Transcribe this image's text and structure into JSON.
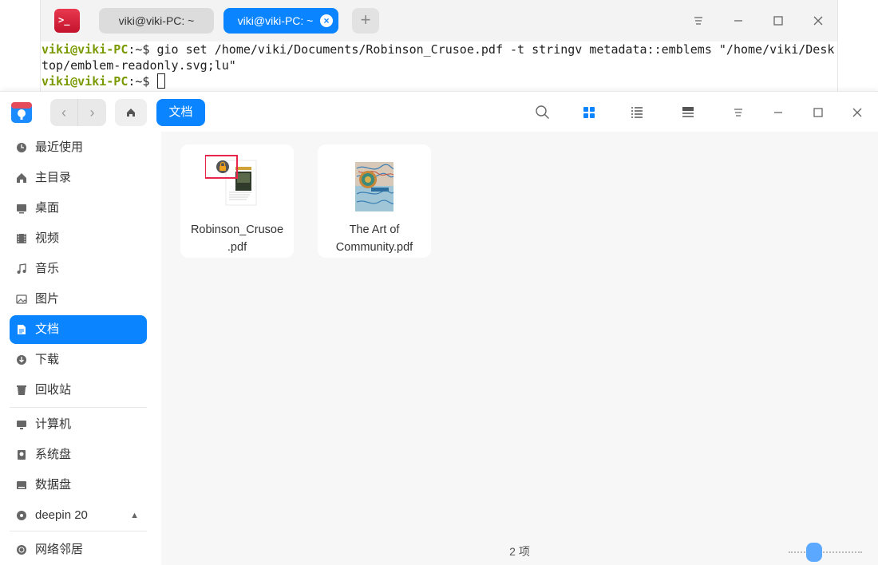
{
  "terminal": {
    "tabs": [
      {
        "label": "viki@viki-PC: ~"
      },
      {
        "label": "viki@viki-PC: ~"
      }
    ],
    "lines": [
      {
        "user": "viki@viki-PC",
        "path": ":~$",
        "command": " gio set /home/viki/Documents/Robinson_Crusoe.pdf -t stringv metadata::emblems \"/home/viki/Desk"
      },
      {
        "continuation": "top/emblem-readonly.svg;lu\""
      },
      {
        "user": "viki@viki-PC",
        "path": ":~$",
        "command": " "
      }
    ]
  },
  "file_manager": {
    "breadcrumb": "文档",
    "sidebar": {
      "items": [
        {
          "label": "最近使用",
          "icon": "clock-icon"
        },
        {
          "label": "主目录",
          "icon": "home-icon"
        },
        {
          "label": "桌面",
          "icon": "desktop-icon"
        },
        {
          "label": "视频",
          "icon": "video-icon"
        },
        {
          "label": "音乐",
          "icon": "music-icon"
        },
        {
          "label": "图片",
          "icon": "picture-icon"
        },
        {
          "label": "文档",
          "icon": "document-icon",
          "active": true
        },
        {
          "label": "下载",
          "icon": "download-icon"
        },
        {
          "label": "回收站",
          "icon": "trash-icon"
        }
      ],
      "devices": [
        {
          "label": "计算机",
          "icon": "computer-icon"
        },
        {
          "label": "系统盘",
          "icon": "disk-icon"
        },
        {
          "label": "数据盘",
          "icon": "disk-icon"
        },
        {
          "label": "deepin 20",
          "icon": "optical-disc-icon",
          "eject": "▲"
        }
      ],
      "network": {
        "label": "网络邻居",
        "icon": "network-icon"
      }
    },
    "files": [
      {
        "name_line1": "Robinson_Crusoe",
        "name_line2": ".pdf",
        "emblem": "lock-emblem"
      },
      {
        "name_line1": "The Art of",
        "name_line2": "Community.pdf"
      }
    ],
    "status": "2 项"
  },
  "colors": {
    "accent": "#0a84ff",
    "prompt_green": "#7a9a01",
    "emblem_highlight": "#e8264a"
  }
}
